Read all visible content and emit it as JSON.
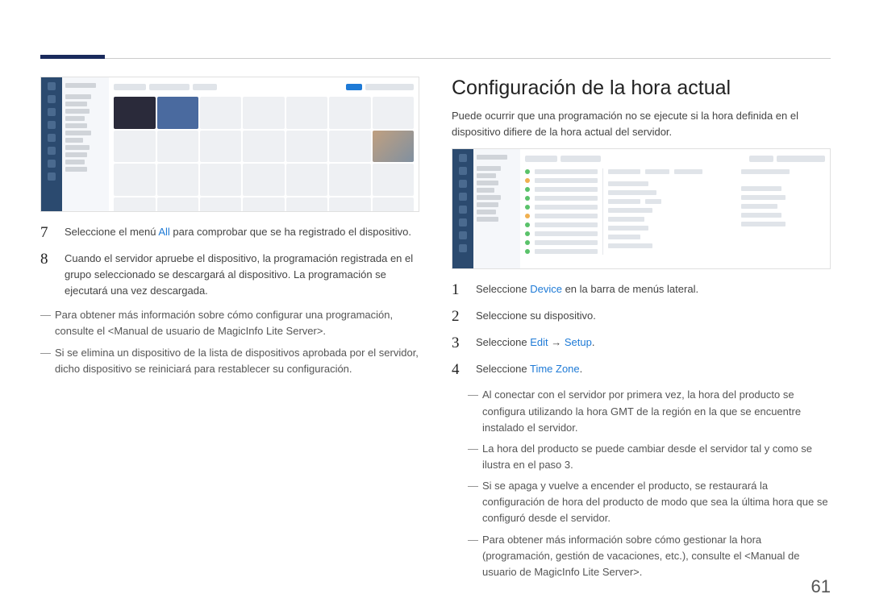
{
  "page_number": "61",
  "left_column": {
    "steps": [
      {
        "num": "7",
        "parts": [
          {
            "t": "Seleccione el menú ",
            "c": false
          },
          {
            "t": "All",
            "c": true
          },
          {
            "t": " para comprobar que se ha registrado el dispositivo.",
            "c": false
          }
        ]
      },
      {
        "num": "8",
        "parts": [
          {
            "t": "Cuando el servidor apruebe el dispositivo, la programación registrada en el grupo seleccionado se descargará al dispositivo. La programación se ejecutará una vez descargada.",
            "c": false
          }
        ]
      }
    ],
    "dashes": [
      {
        "text": "Para obtener más información sobre cómo configurar una programación, consulte el <Manual de usuario de MagicInfo Lite Server>."
      },
      {
        "text": "Si se elimina un dispositivo de la lista de dispositivos aprobada por el servidor, dicho dispositivo se reiniciará para restablecer su configuración."
      }
    ]
  },
  "right_column": {
    "title": "Configuración de la hora actual",
    "intro": "Puede ocurrir que una programación no se ejecute si la hora definida en el dispositivo difiere de la hora actual del servidor.",
    "steps": [
      {
        "num": "1",
        "parts": [
          {
            "t": "Seleccione ",
            "c": false
          },
          {
            "t": "Device",
            "c": true
          },
          {
            "t": " en la barra de menús lateral.",
            "c": false
          }
        ]
      },
      {
        "num": "2",
        "parts": [
          {
            "t": "Seleccione su dispositivo.",
            "c": false
          }
        ]
      },
      {
        "num": "3",
        "parts": [
          {
            "t": "Seleccione ",
            "c": false
          },
          {
            "t": "Edit",
            "c": true
          },
          {
            "t": " → ",
            "c": false
          },
          {
            "t": "Setup",
            "c": true
          },
          {
            "t": ".",
            "c": false
          }
        ]
      },
      {
        "num": "4",
        "parts": [
          {
            "t": "Seleccione ",
            "c": false
          },
          {
            "t": "Time Zone",
            "c": true
          },
          {
            "t": ".",
            "c": false
          }
        ]
      }
    ],
    "dashes": [
      {
        "text": "Al conectar con el servidor por primera vez, la hora del producto se configura utilizando la hora GMT de la región en la que se encuentre instalado el servidor."
      },
      {
        "text": "La hora del producto se puede cambiar desde el servidor tal y como se ilustra en el paso 3."
      },
      {
        "text": "Si se apaga y vuelve a encender el producto, se restaurará la configuración de hora del producto de modo que sea la última hora que se configuró desde el servidor."
      },
      {
        "text": "Para obtener más información sobre cómo gestionar la hora (programación, gestión de vacaciones, etc.), consulte el <Manual de usuario de MagicInfo Lite Server>."
      }
    ]
  }
}
